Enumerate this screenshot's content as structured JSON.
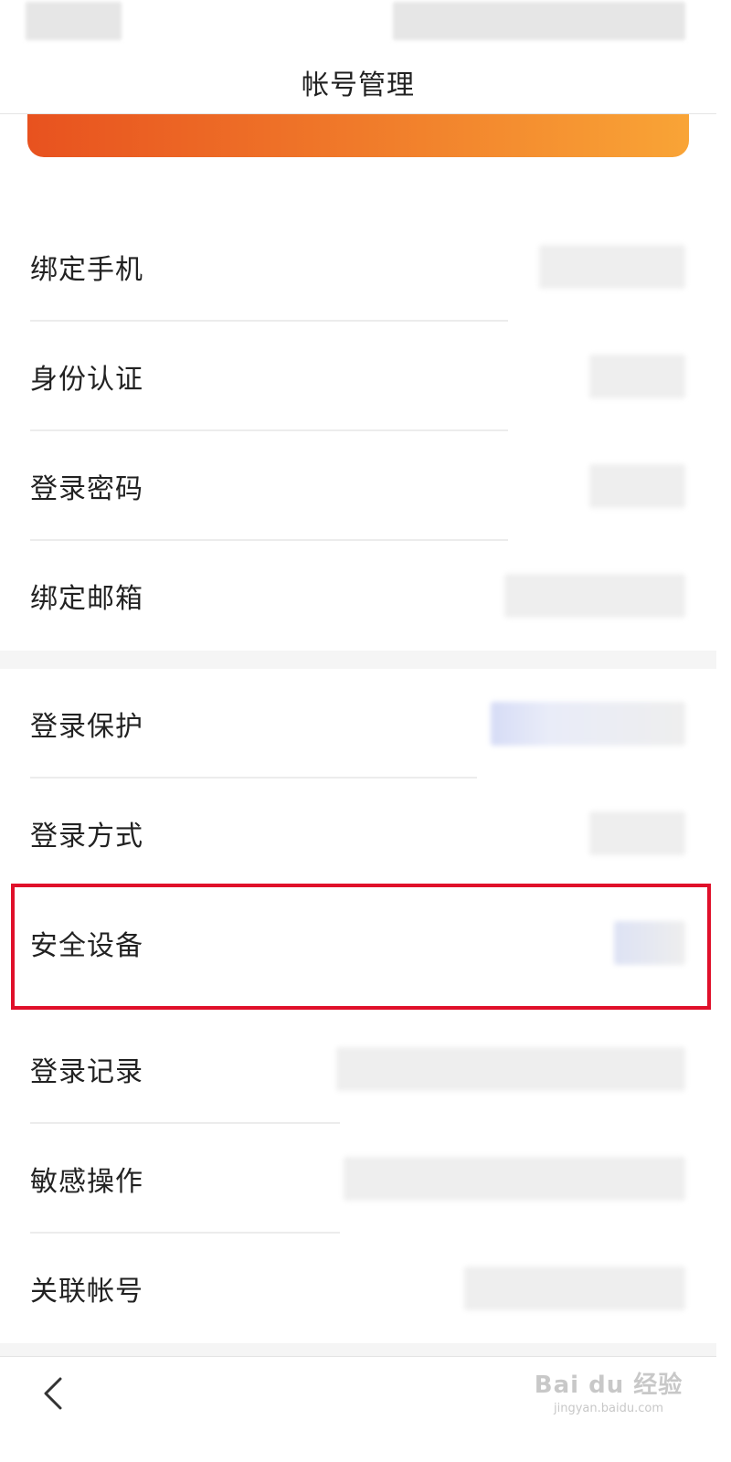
{
  "header": {
    "title": "帐号管理"
  },
  "sections": [
    {
      "items": [
        {
          "id": "bind-phone",
          "label": "绑定手机"
        },
        {
          "id": "identity-verify",
          "label": "身份认证"
        },
        {
          "id": "login-password",
          "label": "登录密码"
        },
        {
          "id": "bind-email",
          "label": "绑定邮箱"
        }
      ]
    },
    {
      "items": [
        {
          "id": "login-protect",
          "label": "登录保护"
        },
        {
          "id": "login-method",
          "label": "登录方式"
        },
        {
          "id": "security-device",
          "label": "安全设备"
        },
        {
          "id": "login-records",
          "label": "登录记录"
        },
        {
          "id": "sensitive-ops",
          "label": "敏感操作"
        },
        {
          "id": "linked-accounts",
          "label": "关联帐号"
        }
      ]
    }
  ],
  "highlighted_item": "security-device",
  "colors": {
    "banner_start": "#e8521f",
    "banner_end": "#f9a436",
    "highlight": "#e0102a",
    "divider": "#ececec",
    "section_gap": "#f5f5f5"
  },
  "footer": {
    "back_icon": "chevron-left-icon",
    "watermark_main": "Bai du 经验",
    "watermark_sub": "jingyan.baidu.com"
  }
}
